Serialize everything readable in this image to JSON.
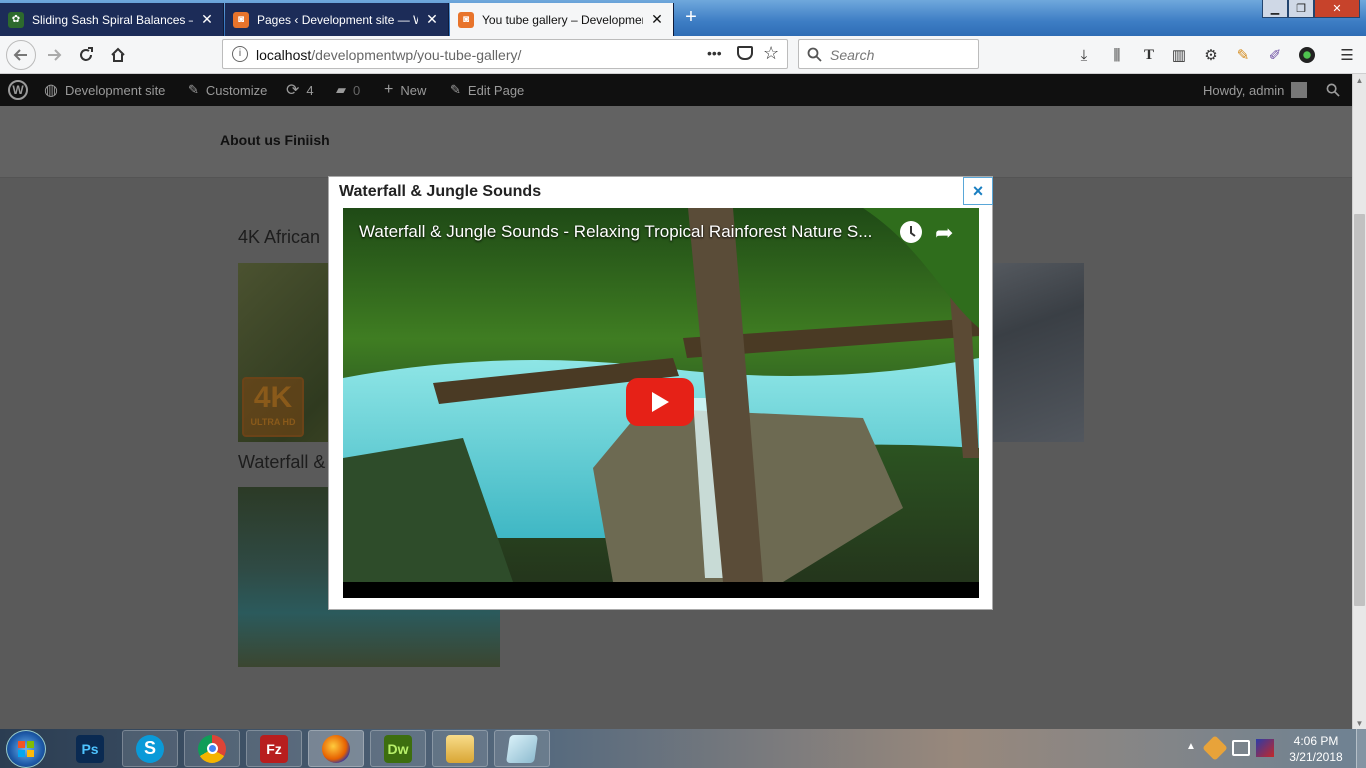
{
  "browser": {
    "tabs": [
      {
        "title": "Sliding Sash Spiral Balances – T",
        "active": false
      },
      {
        "title": "Pages ‹ Development site — W",
        "active": false
      },
      {
        "title": "You tube gallery – Developmen",
        "active": true
      }
    ],
    "url_host": "localhost",
    "url_path": "/developmentwp/you-tube-gallery/",
    "search_placeholder": "Search",
    "page_actions": "•••"
  },
  "admin_bar": {
    "site_name": "Development site",
    "customize": "Customize",
    "updates_count": "4",
    "comments_count": "0",
    "new": "New",
    "edit_page": "Edit Page",
    "howdy": "Howdy, admin"
  },
  "site": {
    "title": "About us Finiish"
  },
  "gallery": {
    "items": [
      {
        "title": "4K African",
        "badge_main": "4K",
        "badge_sub": "ULTRA HD"
      },
      {
        "title": "Waterfall &"
      }
    ]
  },
  "modal": {
    "title": "Waterfall & Jungle Sounds",
    "close": "×",
    "video_title": "Waterfall & Jungle Sounds - Relaxing Tropical Rainforest Nature S..."
  },
  "taskbar": {
    "apps": [
      {
        "name": "Photoshop",
        "label": "Ps",
        "color": "#0a2a52"
      },
      {
        "name": "Skype",
        "label": "S",
        "color": "#0a9ad8"
      },
      {
        "name": "Chrome",
        "label": "",
        "color": "#ffffff"
      },
      {
        "name": "FileZilla",
        "label": "Fz",
        "color": "#b81e1e"
      },
      {
        "name": "Firefox",
        "label": "",
        "color": "#e66000"
      },
      {
        "name": "Dreamweaver",
        "label": "Dw",
        "color": "#3d6e0f"
      },
      {
        "name": "Explorer",
        "label": "",
        "color": "#e6b84a"
      },
      {
        "name": "Notes",
        "label": "",
        "color": "#9bc4d8"
      }
    ],
    "time": "4:06 PM",
    "date": "3/21/2018"
  }
}
